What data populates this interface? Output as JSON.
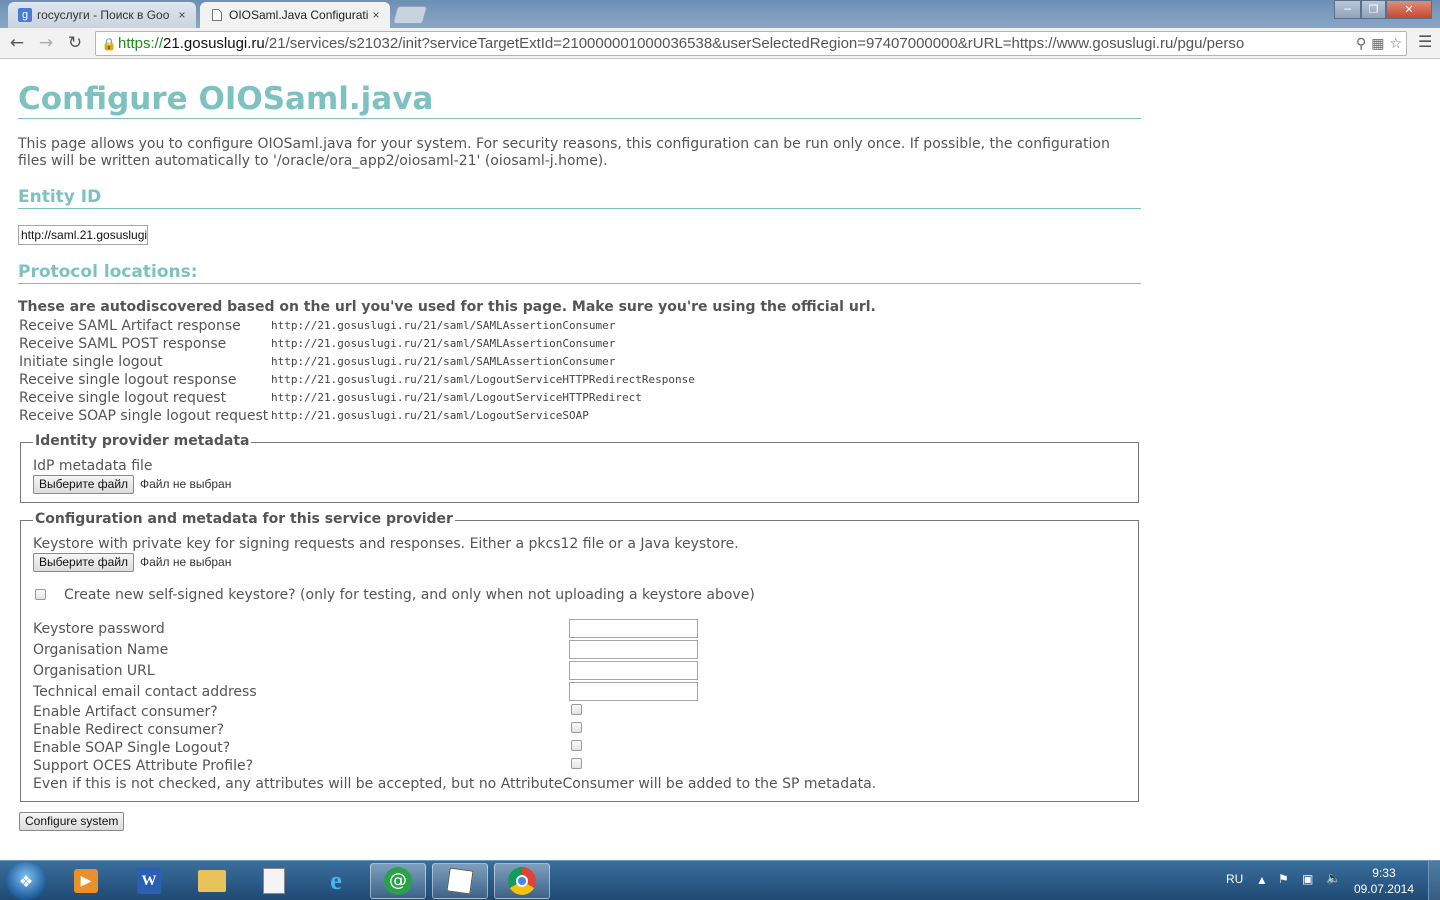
{
  "browser": {
    "tabs": [
      {
        "icon": "google-icon",
        "title": "госуслуги - Поиск в Goo",
        "close": "×",
        "active": false
      },
      {
        "icon": "document-icon",
        "title": "OIOSaml.Java Configurati",
        "close": "×",
        "active": true
      }
    ],
    "url": {
      "scheme": "https://",
      "host": "21.gosuslugi.ru",
      "path": "/21/services/s21032/init?serviceTargetExtId=210000001000036538&userSelectedRegion=97407000000&rURL=https://www.gosuslugi.ru/pgu/perso"
    }
  },
  "page": {
    "title": "Configure OIOSaml.java",
    "intro": "This page allows you to configure OIOSaml.java for your system. For security reasons, this configuration can be run only once. If possible, the configuration files will be written automatically to '/oracle/ora_app2/oiosaml-21' (oiosaml-j.home).",
    "entity_heading": "Entity ID",
    "entity_value": "http://saml.21.gosuslugi",
    "protocol_heading": "Protocol locations:",
    "protocol_notice": "These are autodiscovered based on the url you've used for this page. Make sure you're using the official url.",
    "protocols": [
      {
        "label": "Receive SAML Artifact response",
        "value": "http://21.gosuslugi.ru/21/saml/SAMLAssertionConsumer"
      },
      {
        "label": "Receive SAML POST response",
        "value": "http://21.gosuslugi.ru/21/saml/SAMLAssertionConsumer"
      },
      {
        "label": "Initiate single logout",
        "value": "http://21.gosuslugi.ru/21/saml/SAMLAssertionConsumer"
      },
      {
        "label": "Receive single logout response",
        "value": "http://21.gosuslugi.ru/21/saml/LogoutServiceHTTPRedirectResponse"
      },
      {
        "label": "Receive single logout request",
        "value": "http://21.gosuslugi.ru/21/saml/LogoutServiceHTTPRedirect"
      },
      {
        "label": "Receive SOAP single logout request",
        "value": "http://21.gosuslugi.ru/21/saml/LogoutServiceSOAP"
      }
    ],
    "idp": {
      "legend": "Identity provider metadata",
      "file_label": "IdP metadata file",
      "button": "Выберите файл",
      "status": "Файл не выбран"
    },
    "sp": {
      "legend": "Configuration and metadata for this service provider",
      "keystore_label": "Keystore with private key for signing requests and responses. Either a pkcs12 file or a Java keystore.",
      "button": "Выберите файл",
      "status": "Файл не выбран",
      "create_keystore": "Create new self-signed keystore? (only for testing, and only when not uploading a keystore above)",
      "fields": [
        {
          "label": "Keystore password",
          "value": ""
        },
        {
          "label": "Organisation Name",
          "value": ""
        },
        {
          "label": "Organisation URL",
          "value": ""
        },
        {
          "label": "Technical email contact address",
          "value": ""
        }
      ],
      "checks": [
        {
          "label": "Enable Artifact consumer?",
          "checked": false
        },
        {
          "label": "Enable Redirect consumer?",
          "checked": false
        },
        {
          "label": "Enable SOAP Single Logout?",
          "checked": false
        },
        {
          "label": "Support OCES Attribute Profile?",
          "checked": false
        }
      ],
      "note": "Even if this is not checked, any attributes will be accepted, but no AttributeConsumer will be added to the SP metadata."
    },
    "submit": "Configure system"
  },
  "taskbar": {
    "items": [
      "media-player-icon",
      "word-icon",
      "file-explorer-icon",
      "document-viewer-icon",
      "internet-explorer-icon",
      "mail-agent-icon",
      "paint-icon",
      "chrome-icon"
    ],
    "language": "RU",
    "time": "9:33",
    "date": "09.07.2014"
  },
  "colors": {
    "accent": "#7ec1c1",
    "text": "#555555"
  }
}
